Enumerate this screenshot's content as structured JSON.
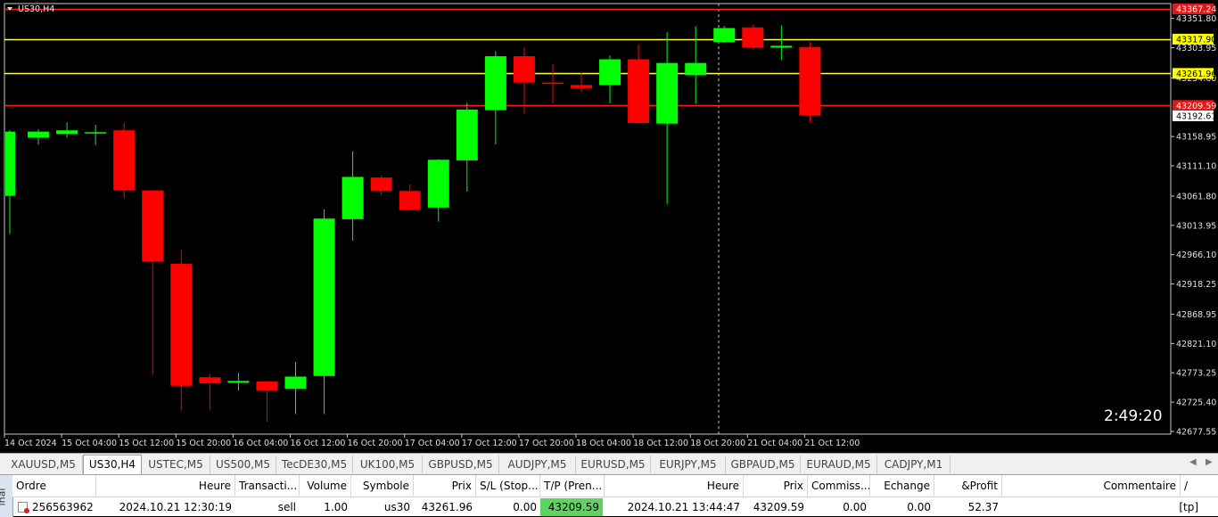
{
  "chart": {
    "title": "US30,H4",
    "clock": "2:49:20",
    "price_axis": {
      "min": 42677.55,
      "max": 43367.24,
      "ticks": [
        "43351.80",
        "43303.95",
        "43254.60",
        "43158.95",
        "43111.10",
        "43061.80",
        "43013.95",
        "42966.10",
        "42918.25",
        "42868.95",
        "42821.10",
        "42773.25",
        "42725.40",
        "42677.55"
      ]
    },
    "levels": [
      {
        "price": 43367.24,
        "label": "43367.24",
        "color": "#ff2020",
        "label_bg": "#e01a1a",
        "label_fg": "#ffffff"
      },
      {
        "price": 43317.9,
        "label": "43317.90",
        "color": "#ffff40",
        "label_bg": "#ffff00",
        "label_fg": "#000000"
      },
      {
        "price": 43261.96,
        "label": "43261.96",
        "color": "#ffff40",
        "label_bg": "#ffff00",
        "label_fg": "#000000"
      },
      {
        "price": 43209.59,
        "label": "43209.59",
        "color": "#ff2020",
        "label_bg": "#e01a1a",
        "label_fg": "#ffffff"
      }
    ],
    "current_price": {
      "price": 43192.61,
      "label": "43192.61"
    },
    "time_labels": [
      "14 Oct 2024",
      "15 Oct 04:00",
      "15 Oct 12:00",
      "15 Oct 20:00",
      "16 Oct 04:00",
      "16 Oct 12:00",
      "16 Oct 20:00",
      "17 Oct 04:00",
      "17 Oct 12:00",
      "17 Oct 20:00",
      "18 Oct 04:00",
      "18 Oct 12:00",
      "18 Oct 20:00",
      "21 Oct 04:00",
      "21 Oct 12:00"
    ],
    "up_color": "#00ff00",
    "down_color": "#ff0000"
  },
  "chart_data": {
    "type": "candlestick",
    "symbol": "US30",
    "timeframe": "H4",
    "candles": [
      {
        "o": 43062,
        "h": 43169,
        "l": 43000,
        "c": 43167
      },
      {
        "o": 43157,
        "h": 43171,
        "l": 43146,
        "c": 43167
      },
      {
        "o": 43163,
        "h": 43182,
        "l": 43157,
        "c": 43169
      },
      {
        "o": 43166,
        "h": 43178,
        "l": 43145,
        "c": 43166
      },
      {
        "o": 43169,
        "h": 43181,
        "l": 43058,
        "c": 43071
      },
      {
        "o": 43071,
        "h": 43071,
        "l": 42770,
        "c": 42955
      },
      {
        "o": 42951,
        "h": 42975,
        "l": 42712,
        "c": 42752
      },
      {
        "o": 42766,
        "h": 42771,
        "l": 42713,
        "c": 42756
      },
      {
        "o": 42757,
        "h": 42773,
        "l": 42744,
        "c": 42760
      },
      {
        "o": 42759,
        "h": 42760,
        "l": 42693,
        "c": 42744
      },
      {
        "o": 42747,
        "h": 42791,
        "l": 42706,
        "c": 42767
      },
      {
        "o": 42768,
        "h": 43040,
        "l": 42706,
        "c": 43025
      },
      {
        "o": 43024,
        "h": 43135,
        "l": 42989,
        "c": 43093
      },
      {
        "o": 43092,
        "h": 43095,
        "l": 43063,
        "c": 43070
      },
      {
        "o": 43070,
        "h": 43081,
        "l": 43038,
        "c": 43039
      },
      {
        "o": 43043,
        "h": 43122,
        "l": 43020,
        "c": 43121
      },
      {
        "o": 43120,
        "h": 43214,
        "l": 43069,
        "c": 43203
      },
      {
        "o": 43202,
        "h": 43298,
        "l": 43146,
        "c": 43290
      },
      {
        "o": 43290,
        "h": 43305,
        "l": 43196,
        "c": 43247
      },
      {
        "o": 43247,
        "h": 43277,
        "l": 43213,
        "c": 43245
      },
      {
        "o": 43243,
        "h": 43263,
        "l": 43232,
        "c": 43238
      },
      {
        "o": 43243,
        "h": 43291,
        "l": 43213,
        "c": 43285
      },
      {
        "o": 43285,
        "h": 43309,
        "l": 43180,
        "c": 43181
      },
      {
        "o": 43180,
        "h": 43329,
        "l": 43049,
        "c": 43279
      },
      {
        "o": 43259,
        "h": 43339,
        "l": 43212,
        "c": 43279
      },
      {
        "o": 43313,
        "h": 43339,
        "l": 43312,
        "c": 43336
      },
      {
        "o": 43337,
        "h": 43341,
        "l": 43301,
        "c": 43304
      },
      {
        "o": 43304,
        "h": 43340,
        "l": 43284,
        "c": 43307
      },
      {
        "o": 43305,
        "h": 43313,
        "l": 43182,
        "c": 43193
      }
    ],
    "price_range": [
      42677.55,
      43367.24
    ]
  },
  "tabs": {
    "items": [
      "XAUUSD,M5",
      "US30,H4",
      "USTEC,M5",
      "US500,M5",
      "TecDE30,M5",
      "UK100,M5",
      "GBPUSD,M5",
      "AUDJPY,M5",
      "EURUSD,M5",
      "EURJPY,M5",
      "GBPAUD,M5",
      "EURAUD,M5",
      "CADJPY,M1"
    ],
    "active": "US30,H4",
    "prev_icon": "triangle-left-icon",
    "next_icon": "triangle-right-icon"
  },
  "terminal": {
    "side_label": "inal",
    "headers": {
      "ordre": "Ordre",
      "heure": "Heure",
      "transaction": "Transacti...",
      "volume": "Volume",
      "symbole": "Symbole",
      "prix": "Prix",
      "sl": "S/L (Stop...",
      "tp": "T/P (Pren...",
      "heure2": "Heure",
      "prix2": "Prix",
      "commission": "Commiss...",
      "echange": "Echange",
      "profit": "&Profit",
      "commentaire": "Commentaire",
      "sort_indicator": "/"
    },
    "row": {
      "ordre": "256563962",
      "heure": "2024.10.21 12:30:19",
      "transaction": "sell",
      "volume": "1.00",
      "symbole": "us30",
      "prix": "43261.96",
      "sl": "0.00",
      "tp": "43209.59",
      "heure2": "2024.10.21 13:44:47",
      "prix2": "43209.59",
      "commission": "0.00",
      "echange": "0.00",
      "profit": "52.37",
      "commentaire": "[tp]",
      "tp_highlight": "#5fd35f"
    }
  }
}
